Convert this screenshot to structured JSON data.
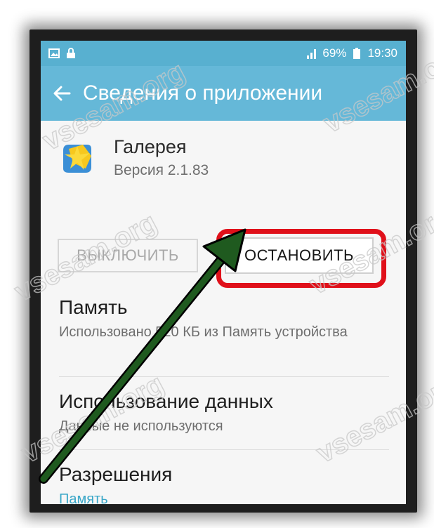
{
  "status_bar": {
    "battery": "69%",
    "time": "19:30"
  },
  "app_bar": {
    "title": "Сведения о приложении",
    "back_icon": "arrow-left-icon"
  },
  "app": {
    "name": "Галерея",
    "version": "Версия 2.1.83",
    "icon": "gallery-app-icon"
  },
  "buttons": {
    "disable": "ВЫКЛЮЧИТЬ",
    "stop": "ОСТАНОВИТЬ"
  },
  "sections": [
    {
      "title": "Память",
      "subtitle": "Использовано 520 КБ из Память устройства"
    },
    {
      "title": "Использование данных",
      "subtitle": "Данные не используются"
    },
    {
      "title": "Разрешения",
      "subtitle": "Память"
    }
  ],
  "watermark": "vsesam.org",
  "colors": {
    "app_bar": "#65b8d8",
    "status_bar": "#58b0d0",
    "highlight": "#e0101a",
    "arrow": "#1f5a1f",
    "accent": "#3aa7c8"
  }
}
